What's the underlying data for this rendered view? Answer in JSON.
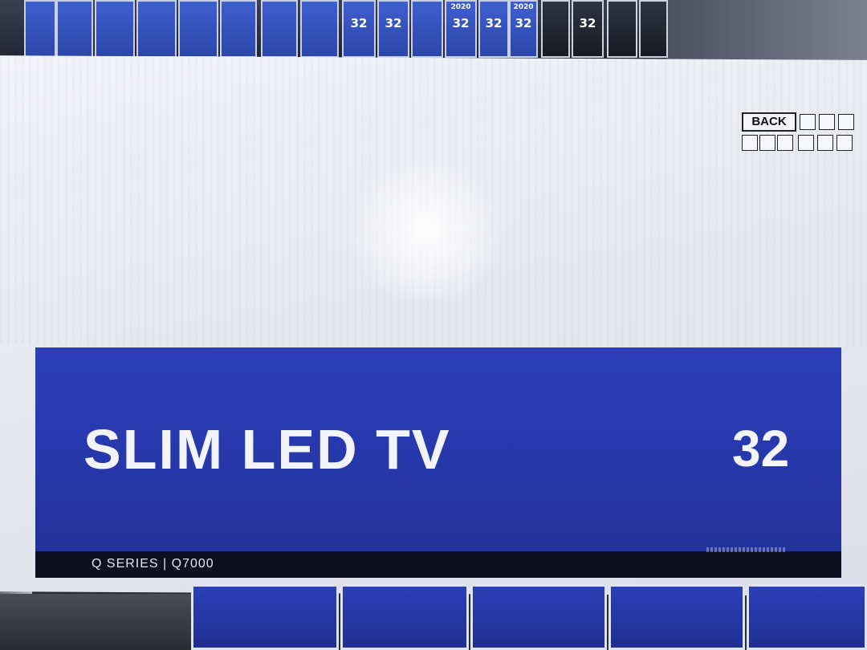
{
  "main_box": {
    "title": "SLIM LED TV",
    "size": "32",
    "series": "Q SERIES | Q7000",
    "back_label": "BACK",
    "banner_color": "#2637a9",
    "box_color": "#eceef4"
  },
  "background_boxes": {
    "labels": [
      "32",
      "32",
      "32",
      "32",
      "32",
      "32"
    ],
    "year": "2020"
  }
}
